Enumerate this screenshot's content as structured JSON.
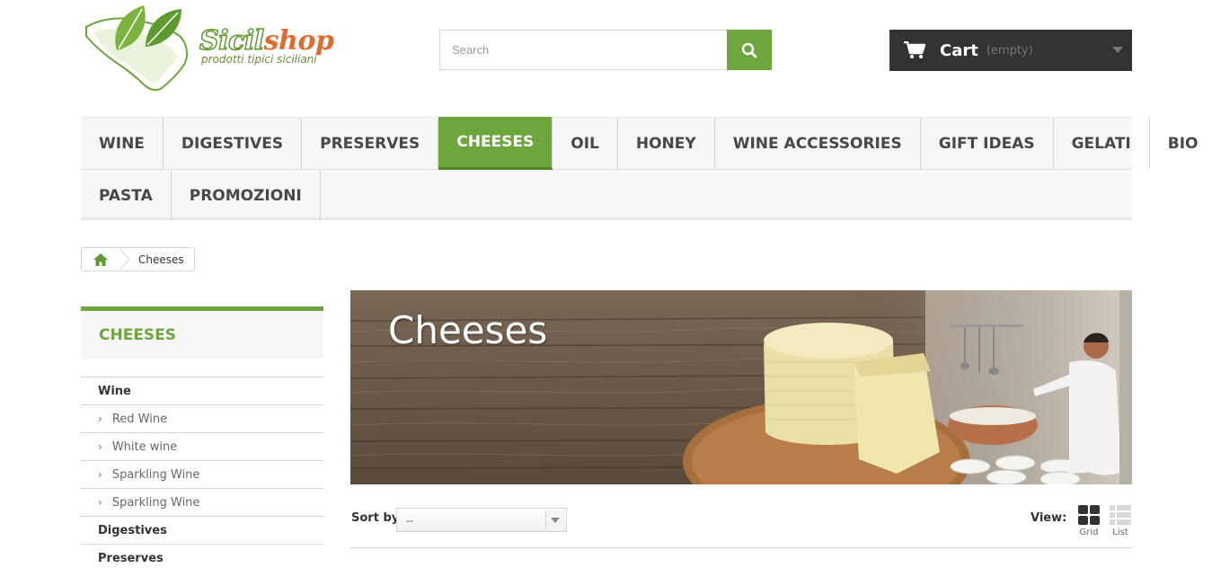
{
  "logo": {
    "name_part1": "Sicil",
    "name_part2": "shop",
    "tagline": "prodotti tipici siciliani"
  },
  "search": {
    "placeholder": "Search"
  },
  "cart": {
    "label": "Cart",
    "status": "(empty)"
  },
  "menu": {
    "row1": [
      "WINE",
      "DIGESTIVES",
      "PRESERVES",
      "CHEESES",
      "OIL",
      "HONEY",
      "WINE ACCESSORIES",
      "GIFT IDEAS",
      "GELATI",
      "BIO"
    ],
    "row2": [
      "PASTA",
      "PROMOZIONI"
    ],
    "active": "CHEESES"
  },
  "breadcrumb": {
    "current": "Cheeses"
  },
  "sidebar": {
    "title": "CHEESES",
    "items": [
      {
        "label": "Wine",
        "level": "top"
      },
      {
        "label": "Red Wine",
        "level": "sub"
      },
      {
        "label": "White wine",
        "level": "sub"
      },
      {
        "label": "Sparkling Wine",
        "level": "sub"
      },
      {
        "label": "Sparkling Wine",
        "level": "sub"
      },
      {
        "label": "Digestives",
        "level": "top"
      },
      {
        "label": "Preserves",
        "level": "top"
      }
    ]
  },
  "banner": {
    "title": "Cheeses"
  },
  "sort": {
    "label": "Sort by",
    "value": "--"
  },
  "view": {
    "label": "View:",
    "grid": "Grid",
    "list": "List"
  },
  "colors": {
    "accent": "#6ea53c",
    "cart_bg": "#333333",
    "menu_bg": "#f6f6f6"
  }
}
